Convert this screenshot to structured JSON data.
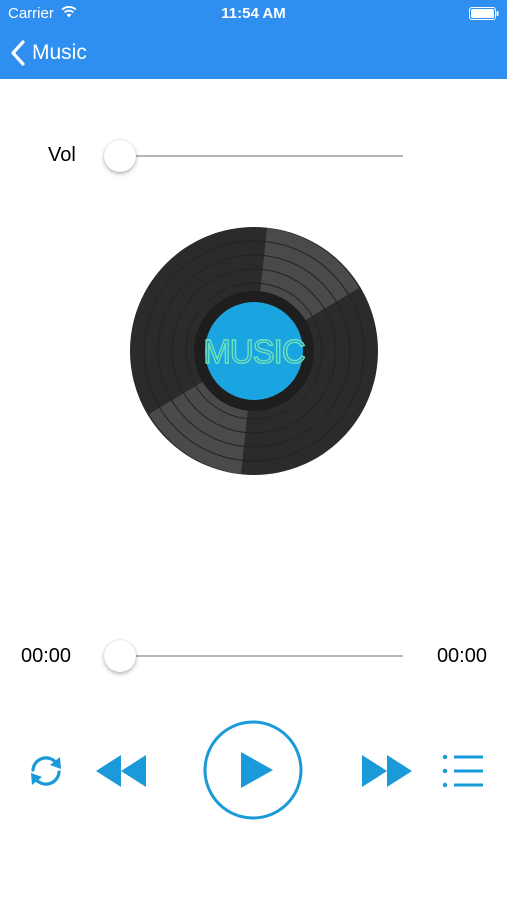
{
  "status_bar": {
    "carrier": "Carrier",
    "time": "11:54 AM",
    "wifi_icon": "wifi-icon",
    "battery_icon": "battery-icon"
  },
  "navbar": {
    "back_label": "Music",
    "back_icon": "chevron-left-icon"
  },
  "volume": {
    "label": "Vol",
    "level": 0.0
  },
  "album_art": {
    "label_text": "MUSIC",
    "label_color": "#1aa5e0",
    "text_color": "#6fe1b8"
  },
  "progress": {
    "current_time": "00:00",
    "total_time": "00:00",
    "fraction": 0.0
  },
  "controls": {
    "repeat_icon": "repeat-icon",
    "rewind_icon": "rewind-icon",
    "play_icon": "play-icon",
    "fast_forward_icon": "fast-forward-icon",
    "playlist_icon": "playlist-icon"
  },
  "colors": {
    "header": "#2f8ff0",
    "accent": "#1a8fd6",
    "record": "#2b2b2b"
  }
}
